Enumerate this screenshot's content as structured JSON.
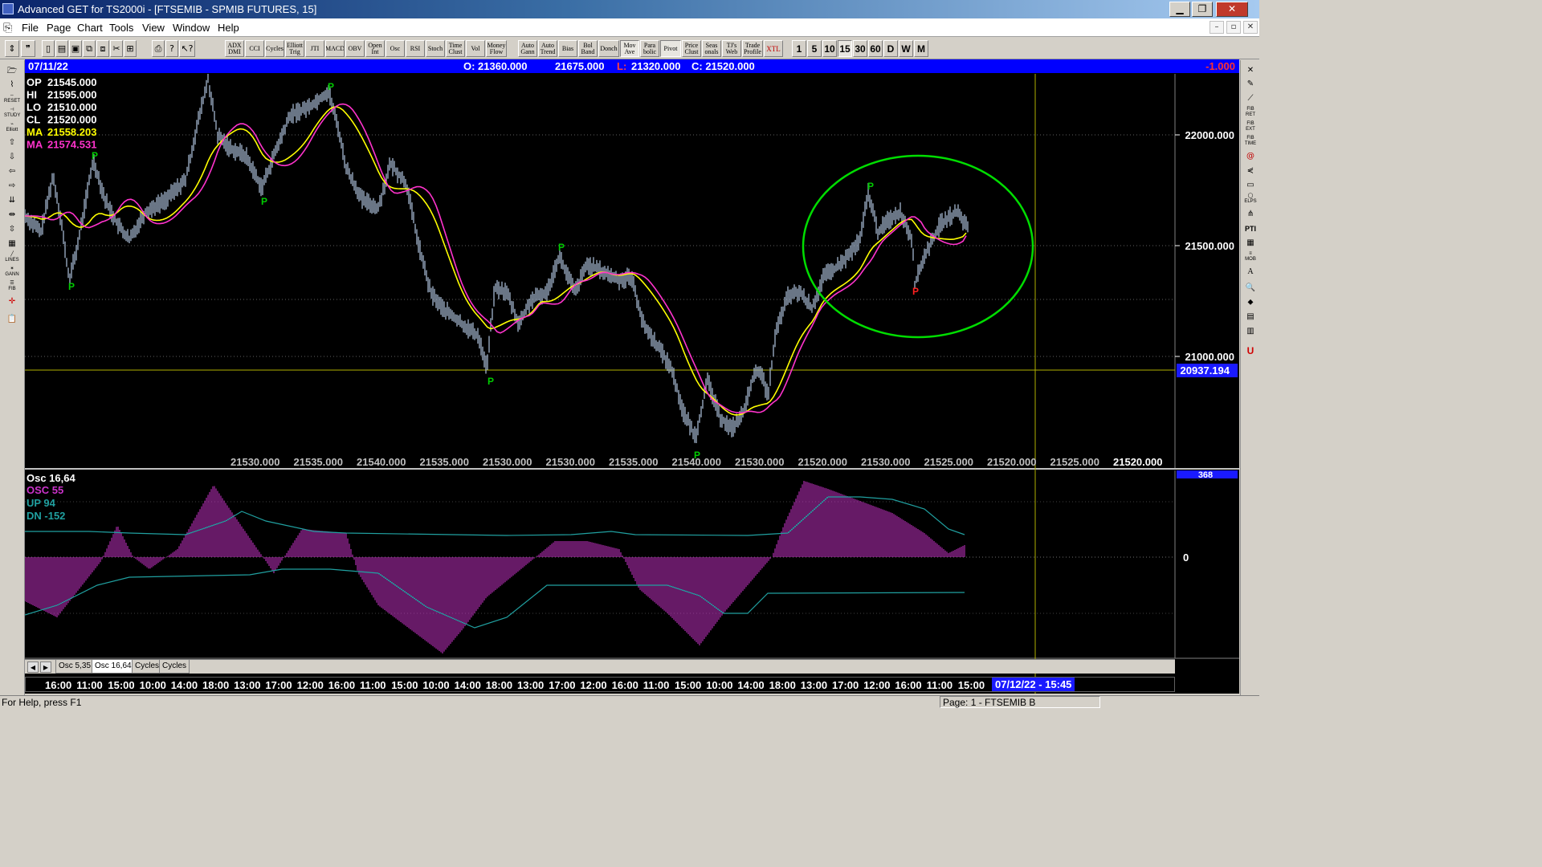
{
  "window": {
    "title": "Advanced GET for TS2000i - [FTSEMIB - SPMIB FUTURES, 15]",
    "minimize": "▁",
    "maximize": "❐",
    "close": "✕"
  },
  "menu": [
    "File",
    "Page",
    "Chart",
    "Tools",
    "View",
    "Window",
    "Help"
  ],
  "mdi_controls": [
    "–",
    "▫",
    "✕"
  ],
  "toolbar": {
    "file_icons": [
      "new-icon",
      "open-icon",
      "save-icon",
      "copy-icon",
      "paste-icon",
      "cut-icon",
      "zoom-icon",
      "print-icon",
      "help-icon",
      "context-help-icon"
    ],
    "studies": [
      "ADX DMI",
      "CCI",
      "Cycles",
      "Elliott Trig",
      "JTI",
      "MACD",
      "OBV",
      "Open Int",
      "Osc",
      "RSI",
      "Stoch",
      "Time Clust",
      "Vol",
      "Money Flow",
      "Auto Gann",
      "Auto Trend",
      "Bias",
      "Bol Band",
      "Donch",
      "Mov Ave",
      "Para bolic",
      "Pivot",
      "Price Clust",
      "Seas onals",
      "TJ's Web",
      "Trade Profile",
      "XTL"
    ],
    "periods": [
      "1",
      "5",
      "10",
      "15",
      "30",
      "60",
      "D",
      "W",
      "M"
    ],
    "active_period": "15"
  },
  "chart": {
    "date": "07/11/22",
    "header_open": "O: 21360.000",
    "header_high": "21675.000",
    "header_low_label": "L:",
    "header_low_value": "21320.000",
    "header_close": "C: 21520.000",
    "header_change": "-1.000",
    "legend": [
      {
        "label": "OP",
        "value": "21545.000",
        "color": "#ffffff"
      },
      {
        "label": "HI",
        "value": "21595.000",
        "color": "#ffffff"
      },
      {
        "label": "LO",
        "value": "21510.000",
        "color": "#ffffff"
      },
      {
        "label": "CL",
        "value": "21520.000",
        "color": "#ffffff"
      },
      {
        "label": "MA",
        "value": "21558.203",
        "color": "#ffff00"
      },
      {
        "label": "MA",
        "value": "21574.531",
        "color": "#ff33cc"
      }
    ],
    "price_axis": [
      "22000.000",
      "21500.000",
      "21000.000"
    ],
    "cursor_price": "20937.194",
    "pivot_labels": [
      "P",
      "P",
      "P",
      "P",
      "P",
      "P",
      "P",
      "P",
      "P",
      "P"
    ],
    "bottom_values": [
      "21530.000",
      "21535.000",
      "21540.000",
      "21535.000",
      "21530.000",
      "21530.000",
      "21535.000",
      "21540.000",
      "21530.000",
      "21520.000",
      "21530.000",
      "21525.000",
      "21520.000",
      "21525.000",
      "21520.000"
    ],
    "colors": {
      "price": "#b0c4de",
      "ma_fast": "#ffff00",
      "ma_slow": "#ff33cc",
      "pivot_high": "#00cc00",
      "pivot_low_red": "#ff2020",
      "ellipse": "#00dd00",
      "header_bg": "#0000ff"
    }
  },
  "oscillator": {
    "title": "Osc 16,64",
    "osc_label": "OSC 55",
    "up_label": "UP  94",
    "dn_label": "DN  -152",
    "axis_top": "368",
    "axis_zero": "0",
    "colors": {
      "osc": "#cc33cc",
      "band": "#20a0a0"
    }
  },
  "tabs": [
    "Osc 5,35",
    "Osc 16,64",
    "Cycles",
    "Cycles"
  ],
  "active_tab": "Osc 16,64",
  "time_axis": [
    "16:00",
    "11:00",
    "15:00",
    "10:00",
    "14:00",
    "18:00",
    "13:00",
    "17:00",
    "12:00",
    "16:00",
    "11:00",
    "15:00",
    "10:00",
    "14:00",
    "18:00",
    "13:00",
    "17:00",
    "12:00",
    "16:00",
    "11:00",
    "15:00",
    "10:00",
    "14:00",
    "18:00",
    "13:00",
    "17:00",
    "12:00",
    "16:00",
    "11:00",
    "15:00"
  ],
  "cursor_time": "07/12/22 - 15:45",
  "status": {
    "help": "For Help, press F1",
    "page": "Page: 1 - FTSEMIB B"
  }
}
